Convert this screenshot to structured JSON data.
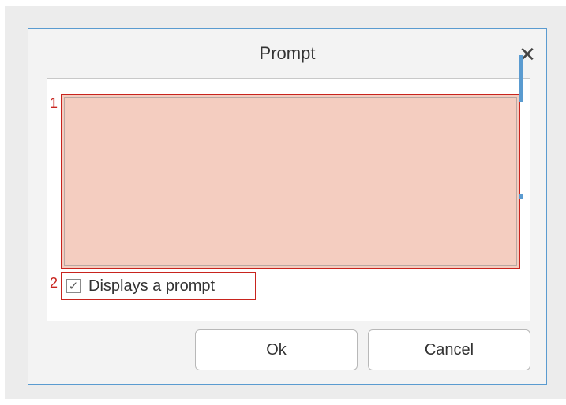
{
  "dialog": {
    "title": "Prompt",
    "close_glyph": "✕",
    "annotations": {
      "textarea_num": "1",
      "checkbox_num": "2"
    },
    "prompt_text": "",
    "checkbox": {
      "label": "Displays a prompt",
      "checked": true,
      "glyph": "✓"
    },
    "buttons": {
      "ok_label": "Ok",
      "cancel_label": "Cancel"
    },
    "colors": {
      "accent": "#5a9bd0",
      "highlight": "#c8241e",
      "highlight_fill": "#f4cdc0"
    }
  }
}
